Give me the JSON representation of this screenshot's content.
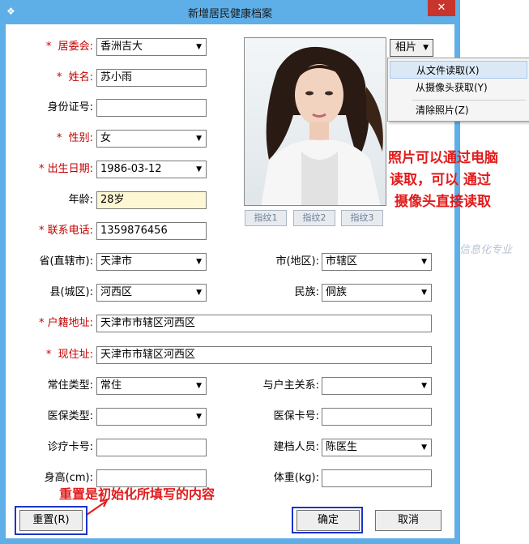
{
  "window": {
    "title": "新增居民健康档案",
    "close_glyph": "✕"
  },
  "form": {
    "committee": {
      "label": "居委会:",
      "required_mark": "*",
      "value": "香洲吉大"
    },
    "name": {
      "label": "姓名:",
      "required_mark": "*",
      "value": "苏小雨"
    },
    "id_number": {
      "label": "身份证号:",
      "value": ""
    },
    "gender": {
      "label": "性别:",
      "required_mark": "*",
      "value": "女"
    },
    "birth_date": {
      "label": "出生日期:",
      "required_mark": "*",
      "value": "1986-03-12"
    },
    "age": {
      "label": "年龄:",
      "value": "28岁"
    },
    "phone": {
      "label": "联系电话:",
      "required_mark": "*",
      "value": "1359876456"
    },
    "province": {
      "label": "省(直辖市):",
      "value": "天津市"
    },
    "city": {
      "label": "市(地区):",
      "value": "市辖区"
    },
    "county": {
      "label": "县(城区):",
      "value": "河西区"
    },
    "ethnicity": {
      "label": "民族:",
      "value": "侗族"
    },
    "registered_address": {
      "label": "户籍地址:",
      "required_mark": "*",
      "value": "天津市市辖区河西区"
    },
    "current_address": {
      "label": "现住址:",
      "required_mark": "*",
      "value": "天津市市辖区河西区"
    },
    "residence_type": {
      "label": "常住类型:",
      "value": "常住"
    },
    "relation": {
      "label": "与户主关系:",
      "value": ""
    },
    "insurance_type": {
      "label": "医保类型:",
      "value": ""
    },
    "insurance_card": {
      "label": "医保卡号:",
      "value": ""
    },
    "clinic_card": {
      "label": "诊疗卡号:",
      "value": ""
    },
    "record_creator": {
      "label": "建档人员:",
      "value": "陈医生"
    },
    "height": {
      "label": "身高(cm):",
      "value": ""
    },
    "weight": {
      "label": "体重(kg):",
      "value": ""
    }
  },
  "photo": {
    "button_label": "相片",
    "menu": [
      "从文件读取(X)",
      "从摄像头获取(Y)",
      "清除照片(Z)"
    ],
    "fingerprints": [
      "指纹1",
      "指纹2",
      "指纹3"
    ]
  },
  "annotations": {
    "photo_note": [
      "照片可以通过电脑",
      "读取，可以  通过",
      "摄像头直接读取"
    ],
    "reset_note": "重置是初始化所填写的内容",
    "watermark": "信息化专业"
  },
  "buttons": {
    "reset": "重置(R)",
    "ok": "确定",
    "cancel": "取消"
  },
  "colors": {
    "title_bar": "#5eaee8",
    "required": "#c40000",
    "annotation": "#e01b1b",
    "highlight_box": "#1c34c8"
  }
}
